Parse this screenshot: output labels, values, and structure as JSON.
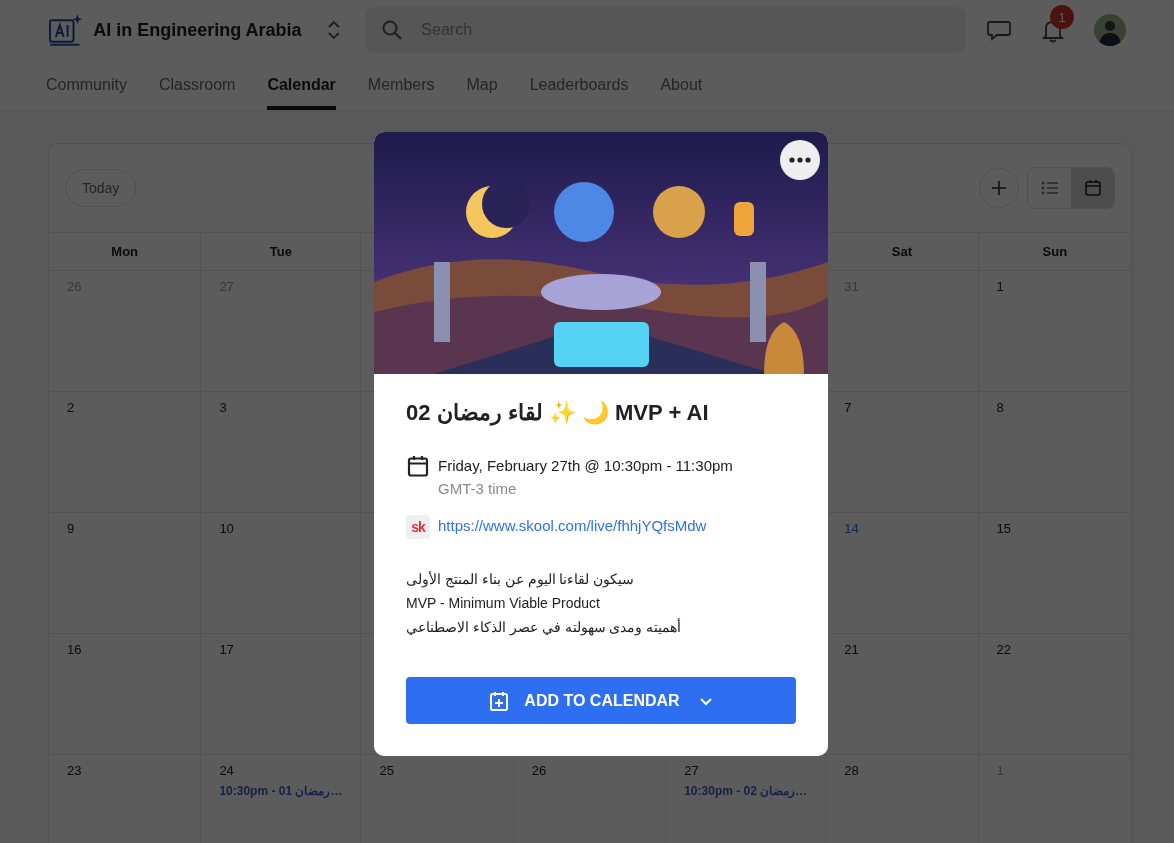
{
  "header": {
    "community_name": "AI in Engineering Arabia",
    "search": {
      "placeholder": "Search"
    },
    "notification_count": "1"
  },
  "tabs": [
    {
      "label": "Community",
      "selected": false
    },
    {
      "label": "Classroom",
      "selected": false
    },
    {
      "label": "Calendar",
      "selected": true
    },
    {
      "label": "Members",
      "selected": false
    },
    {
      "label": "Map",
      "selected": false
    },
    {
      "label": "Leaderboards",
      "selected": false
    },
    {
      "label": "About",
      "selected": false
    }
  ],
  "calendar": {
    "today_button": "Today",
    "views": [
      {
        "kind": "list",
        "selected": false
      },
      {
        "kind": "month",
        "selected": true
      }
    ],
    "weekdays": {
      "mon": "Mon",
      "tue": "Tue",
      "sat": "Sat",
      "sun": "Sun"
    },
    "weeks": [
      {
        "mon": {
          "day": "26",
          "muted": true,
          "today": false
        },
        "tue": {
          "day": "27",
          "muted": true,
          "today": false
        },
        "sat": {
          "day": "31",
          "muted": true,
          "today": false
        },
        "sun": {
          "day": "1",
          "muted": false,
          "today": false
        }
      },
      {
        "mon": {
          "day": "2",
          "muted": false,
          "today": false
        },
        "tue": {
          "day": "3",
          "muted": false,
          "today": false
        },
        "sat": {
          "day": "7",
          "muted": false,
          "today": false
        },
        "sun": {
          "day": "8",
          "muted": false,
          "today": false
        }
      },
      {
        "mon": {
          "day": "9",
          "muted": false,
          "today": false
        },
        "tue": {
          "day": "10",
          "muted": false,
          "today": false
        },
        "sat": {
          "day": "14",
          "muted": false,
          "today": true
        },
        "sun": {
          "day": "15",
          "muted": false,
          "today": false
        }
      },
      {
        "mon": {
          "day": "16",
          "muted": false,
          "today": false
        },
        "tue": {
          "day": "17",
          "muted": false,
          "today": false
        },
        "sat": {
          "day": "21",
          "muted": false,
          "today": false
        },
        "sun": {
          "day": "22",
          "muted": false,
          "today": false
        }
      },
      {
        "mon": {
          "day": "23",
          "muted": false,
          "today": false
        },
        "tue": {
          "day": "24",
          "muted": false,
          "today": false,
          "events": [
            "10:30pm - 01 رمضان…"
          ]
        },
        "wed": {
          "day": "25",
          "muted": false,
          "today": false
        },
        "thu": {
          "day": "26",
          "muted": false,
          "today": false
        },
        "fri": {
          "day": "27",
          "muted": false,
          "today": false,
          "events": [
            "10:30pm - 02 رمضان…"
          ]
        },
        "sat": {
          "day": "28",
          "muted": false,
          "today": false
        },
        "sun": {
          "day": "1",
          "muted": true,
          "today": false
        }
      }
    ]
  },
  "event_modal": {
    "title": "MVP + AI 🌙 ✨ لقاء رمضان 02",
    "date": "Friday, February 27th @ 10:30pm - 11:30pm",
    "timezone": "GMT-3 time",
    "link_badge": "sk",
    "link": "https://www.skool.com/live/fhhjYQfsMdw",
    "description": [
      "سيكون لقاءنا اليوم عن بناء المنتج الأولى",
      "MVP - Minimum Viable Product",
      "أهميته ومدى سهولته في عصر الذكاء الاصطناعي"
    ],
    "button": "ADD TO CALENDAR"
  }
}
